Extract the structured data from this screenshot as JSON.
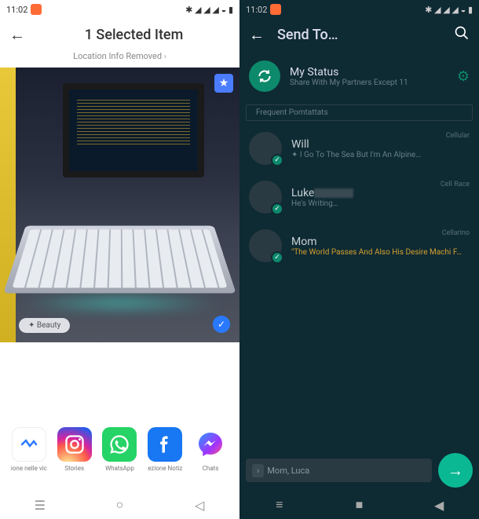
{
  "left": {
    "status_time": "11:02",
    "header_title": "1 Selected Item",
    "header_sub": "Location Info Removed",
    "beauty_label": "Beauty",
    "share": [
      {
        "label": "ione nelle vic"
      },
      {
        "label": "Stories"
      },
      {
        "label": "WhatsApp"
      },
      {
        "label": "ezione Notiz"
      },
      {
        "label": "Chats"
      }
    ]
  },
  "right": {
    "status_time": "11:02",
    "header_title": "Send To…",
    "my_status": {
      "title": "My Status",
      "sub": "Share With My Partners Except 11"
    },
    "section": "Frequent Pomtattats",
    "contacts": [
      {
        "name": "Will",
        "type": "Cellular",
        "status": "I Go To The Sea But I'm An Alpine…"
      },
      {
        "name": "Luke",
        "type": "Cell Race",
        "status": "He's Writing…"
      },
      {
        "name": "Mom",
        "type": "Cellarino",
        "status": "\"The World Passes And Also His Desire Machi F…"
      }
    ],
    "send_names": "Mom, Luca"
  }
}
